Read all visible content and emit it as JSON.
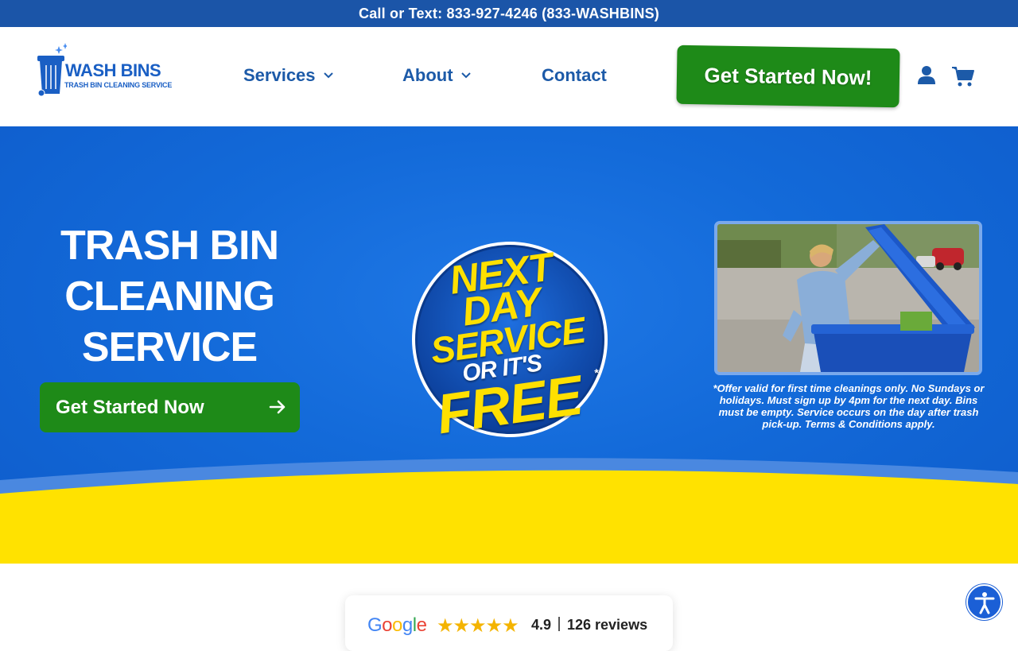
{
  "topbar": {
    "text": "Call or Text: 833-927-4246 (833-WASHBINS)"
  },
  "logo": {
    "wordmark": "WASH BINS",
    "tagline": "TRASH BIN CLEANING SERVICE"
  },
  "nav": {
    "items": [
      {
        "label": "Services",
        "has_dropdown": true
      },
      {
        "label": "About",
        "has_dropdown": true
      },
      {
        "label": "Contact",
        "has_dropdown": false
      }
    ],
    "cta_label": "Get Started Now!",
    "icons": [
      "user-icon",
      "cart-icon"
    ]
  },
  "hero": {
    "title_lines": [
      "TRASH BIN",
      "CLEANING",
      "SERVICE"
    ],
    "cta_label": "Get Started Now",
    "badge": {
      "line1": "NEXT",
      "line2": "DAY",
      "line3": "SERVICE",
      "line4": "OR IT'S",
      "line5": "FREE",
      "asterisk": "*"
    },
    "disclaimer": "*Offer valid for first time cleanings only. No Sundays or holidays. Must sign up by 4pm for the next day. Bins must be empty. Service occurs on the day after trash pick-up. Terms & Conditions apply."
  },
  "reviews": {
    "source": "Google",
    "stars": "★★★★★",
    "rating": "4.9",
    "count": "126 reviews"
  },
  "colors": {
    "brand_blue": "#1b55a8",
    "hero_blue": "#136ad9",
    "cta_green": "#1e8a18",
    "accent_yellow": "#ffe000"
  }
}
